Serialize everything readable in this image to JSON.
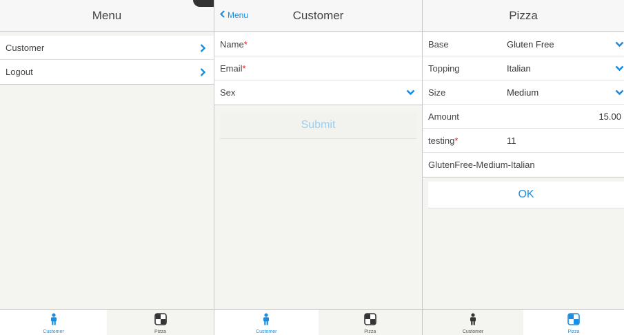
{
  "menu_panel": {
    "title": "Menu",
    "items": [
      {
        "label": "Customer"
      },
      {
        "label": "Logout"
      }
    ],
    "tabs": [
      {
        "label": "Customer",
        "active": true
      },
      {
        "label": "Pizza",
        "active": false
      }
    ]
  },
  "customer_panel": {
    "title": "Customer",
    "back_label": "Menu",
    "fields": [
      {
        "label": "Name",
        "required_mark": "*"
      },
      {
        "label": "Email",
        "required_mark": "*"
      },
      {
        "label": "Sex"
      }
    ],
    "submit_label": "Submit",
    "tabs": [
      {
        "label": "Customer",
        "active": true
      },
      {
        "label": "Pizza",
        "active": false
      }
    ]
  },
  "pizza_panel": {
    "title": "Pizza",
    "rows": [
      {
        "label": "Base",
        "value": "Gluten Free"
      },
      {
        "label": "Topping",
        "value": "Italian"
      },
      {
        "label": "Size",
        "value": "Medium"
      },
      {
        "label": "Amount",
        "value": "15.00"
      },
      {
        "label": "testing",
        "required_mark": "*",
        "value": "11"
      },
      {
        "label": "GlutenFree-Medium-Italian"
      }
    ],
    "ok_label": "OK",
    "tabs": [
      {
        "label": "Customer",
        "active": false
      },
      {
        "label": "Pizza",
        "active": true
      }
    ]
  },
  "colors": {
    "accent": "#1a8de0",
    "required": "#e02020",
    "background": "#f4f4f1"
  }
}
